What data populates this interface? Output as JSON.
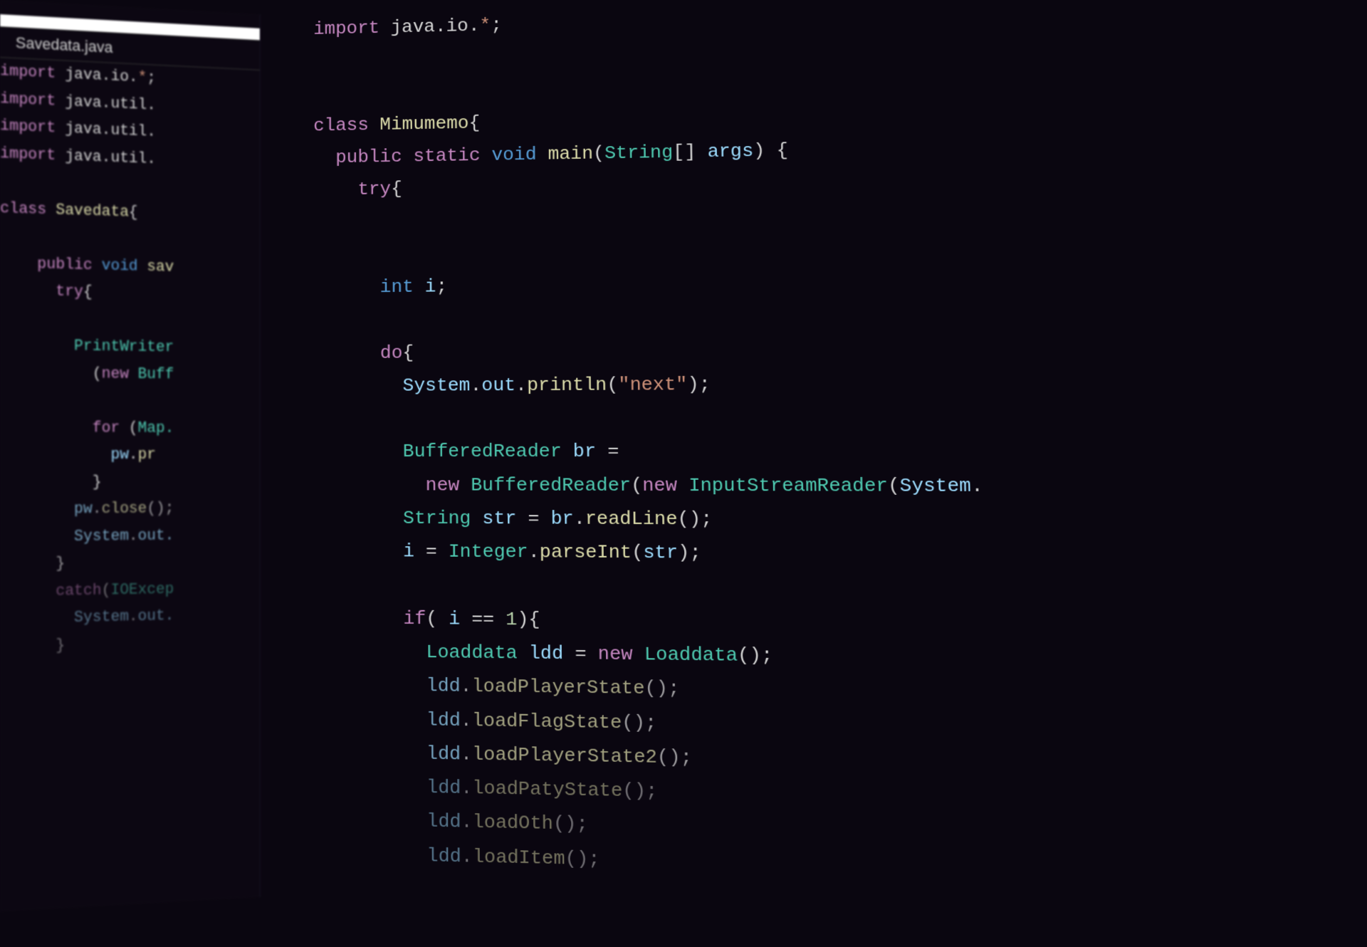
{
  "sidebar": {
    "active_tab_placeholder": " ",
    "tab_title": "Savedata.java",
    "lines": {
      "l1": "import java.io.*;",
      "l1_tokens": {
        "kw": "import",
        "pkg": " java.io.",
        "star": "*",
        "semi": ";"
      },
      "l2_tokens": {
        "kw": "import",
        "pkg": " java.util."
      },
      "l3_tokens": {
        "kw": "import",
        "pkg": " java.util."
      },
      "l4_tokens": {
        "kw": "import",
        "pkg": " java.util."
      },
      "l6_tokens": {
        "kw": "class",
        "name": " Savedata",
        "brace": "{"
      },
      "l8_tokens": {
        "kw1": "    public",
        "kw2": " void",
        "name": " sav"
      },
      "l9_tokens": {
        "kw": "      try",
        "brace": "{"
      },
      "l11_tokens": {
        "name": "        PrintWriter"
      },
      "l12_tokens": {
        "paren": "          (",
        "kw": "new",
        "name": " Buff"
      },
      "l14_tokens": {
        "kw": "          for",
        "paren": " (",
        "type": "Map."
      },
      "l15_tokens": {
        "var": "            pw",
        "dot": ".",
        "fn": "pr"
      },
      "l16_tokens": {
        "brace": "          }"
      },
      "l17_tokens": {
        "var": "        pw",
        "dot": ".",
        "fn": "close",
        "paren": "();"
      },
      "l18_tokens": {
        "var": "        System",
        "dot": ".",
        "out": "out."
      },
      "l19_tokens": {
        "brace": "      }"
      },
      "l20_tokens": {
        "kw": "      catch",
        "paren": "(",
        "type": "IOExcep"
      },
      "l21_tokens": {
        "var": "        System",
        "dot": ".",
        "out": "out."
      },
      "l22_tokens": {
        "brace": "      }"
      }
    }
  },
  "main": {
    "lines": {
      "m1": {
        "kw": "import",
        "pkg": " java.io.",
        "star": "*",
        "semi": ";"
      },
      "m3": {
        "kw": "class",
        "name": " Mimumemo",
        "brace": "{"
      },
      "m4": {
        "kw1": "  public",
        "kw2": " static",
        "kw3": " void",
        "fn": " main",
        "paren": "(",
        "type": "String",
        "arr": "[] ",
        "arg": "args",
        "paren2": ") {"
      },
      "m5": {
        "kw": "    try",
        "brace": "{"
      },
      "m7": {
        "type": "      int",
        "var": " i",
        "semi": ";"
      },
      "m9": {
        "kw": "      do",
        "brace": "{"
      },
      "m10": {
        "sys": "        System",
        "dot": ".",
        "out": "out",
        "dot2": ".",
        "fn": "println",
        "paren": "(",
        "str": "\"next\"",
        "paren2": ");"
      },
      "m12": {
        "type": "        BufferedReader",
        "var": " br",
        "op": " ="
      },
      "m13": {
        "kw": "          new",
        "type": " BufferedReader",
        "paren": "(",
        "kw2": "new",
        "type2": " InputStreamReader",
        "paren2": "(",
        "sys": "System",
        "dot": "."
      },
      "m14": {
        "type": "        String",
        "var": " str",
        "op": " = ",
        "obj": "br",
        "dot": ".",
        "fn": "readLine",
        "paren": "();"
      },
      "m15": {
        "var": "        i",
        "op": " = ",
        "type": "Integer",
        "dot": ".",
        "fn": "parseInt",
        "paren": "(",
        "arg": "str",
        "paren2": ");"
      },
      "m17": {
        "kw": "        if",
        "paren": "( ",
        "var": "i",
        "op": " == ",
        "num": "1",
        "paren2": "){"
      },
      "m18": {
        "type": "          Loaddata",
        "var": " ldd",
        "op": " = ",
        "kw": "new",
        "type2": " Loaddata",
        "paren": "();"
      },
      "m19": {
        "obj": "          ldd",
        "dot": ".",
        "fn": "loadPlayerState",
        "paren": "();"
      },
      "m20": {
        "obj": "          ldd",
        "dot": ".",
        "fn": "loadFlagState",
        "paren": "();"
      },
      "m21": {
        "obj": "          ldd",
        "dot": ".",
        "fn": "loadPlayerState2",
        "paren": "();"
      },
      "m22": {
        "obj": "          ldd",
        "dot": ".",
        "fn": "loadPatyState",
        "paren": "();"
      },
      "m23": {
        "obj": "          ldd",
        "dot": ".",
        "fn": "loadOth",
        "paren": "();"
      },
      "m24": {
        "obj": "          ldd",
        "dot": ".",
        "fn": "loadItem",
        "paren": "();"
      }
    }
  }
}
